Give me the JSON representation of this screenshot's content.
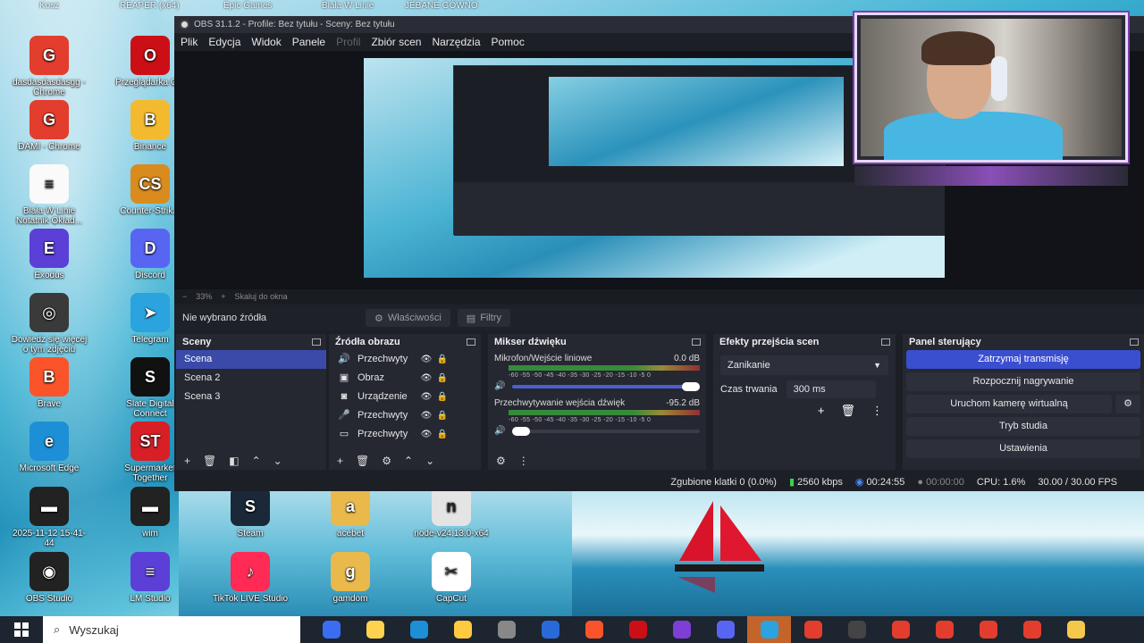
{
  "topbar": {
    "items": [
      "Kosz",
      "REAPER (x64)",
      "Epic Games",
      "Biała W Linie",
      "JEBANE GÓWNO"
    ]
  },
  "desktop": {
    "icons": [
      {
        "label": "dasdasdasdasgg - Chrome",
        "color": "#e33d2e",
        "glyph": "G"
      },
      {
        "label": "Przeglądarka O...",
        "color": "#cc0f16",
        "glyph": "O"
      },
      {
        "label": "DAMI - Chrome",
        "color": "#e33d2e",
        "glyph": "G"
      },
      {
        "label": "Binance",
        "color": "#f3ba2f",
        "glyph": "B"
      },
      {
        "label": "Biała W Linie Notatnik Okład...",
        "color": "#fafafa",
        "glyph": "≡"
      },
      {
        "label": "Counter-Strik...",
        "color": "#d98b1e",
        "glyph": "CS"
      },
      {
        "label": "Exodus",
        "color": "#5b3fd6",
        "glyph": "E"
      },
      {
        "label": "Discord",
        "color": "#5865f2",
        "glyph": "D"
      },
      {
        "label": "Dowiedz się więcej o tym zdjęciu",
        "color": "#3a3a3a",
        "glyph": "◎"
      },
      {
        "label": "Telegram",
        "color": "#2aa3df",
        "glyph": "➤"
      },
      {
        "label": "Brave",
        "color": "#fb542b",
        "glyph": "B"
      },
      {
        "label": "Slate Digital Connect",
        "color": "#111",
        "glyph": "S"
      },
      {
        "label": "Microsoft Edge",
        "color": "#1d8fd6",
        "glyph": "e"
      },
      {
        "label": "Supermarket Together",
        "color": "#d81f26",
        "glyph": "ST"
      },
      {
        "label": "2025-11-12 15-41-44",
        "color": "#222",
        "glyph": "▬"
      },
      {
        "label": "wim",
        "color": "#222",
        "glyph": "▬"
      },
      {
        "label": "Steam",
        "color": "#1b2838",
        "glyph": "S"
      },
      {
        "label": "acebet",
        "color": "#e9b94b",
        "glyph": "a"
      },
      {
        "label": "node-v24.13.0-x64",
        "color": "#e4e4e4",
        "glyph": "n"
      },
      {
        "label": "OBS Studio",
        "color": "#222",
        "glyph": "◉"
      },
      {
        "label": "LM Studio",
        "color": "#5b3fd6",
        "glyph": "≡"
      },
      {
        "label": "TikTok LIVE Studio",
        "color": "#ff2b54",
        "glyph": "♪"
      },
      {
        "label": "gamdom",
        "color": "#e9b94b",
        "glyph": "g"
      },
      {
        "label": "CapCut",
        "color": "#fff",
        "glyph": "✂"
      }
    ]
  },
  "obs": {
    "title": "OBS 31.1.2 - Profile: Bez tytułu - Sceny: Bez tytułu",
    "menu": [
      "Plik",
      "Edycja",
      "Widok",
      "Panele",
      "Profil",
      "Zbiór scen",
      "Narzędzia",
      "Pomoc"
    ],
    "zoom": {
      "minus": "−",
      "value": "33%",
      "plus": "+",
      "fit": "Skaluj do okna"
    },
    "source_bar": {
      "none": "Nie wybrano źródła",
      "props": "Właściwości",
      "filters": "Filtry"
    },
    "scenes": {
      "title": "Sceny",
      "items": [
        "Scena",
        "Scena 2",
        "Scena 3"
      ]
    },
    "sources": {
      "title": "Źródła obrazu",
      "items": [
        {
          "icon": "🔊",
          "name": "Przechwyty"
        },
        {
          "icon": "▣",
          "name": "Obraz"
        },
        {
          "icon": "◙",
          "name": "Urządzenie"
        },
        {
          "icon": "🎤",
          "name": "Przechwyty"
        },
        {
          "icon": "▭",
          "name": "Przechwyty"
        }
      ]
    },
    "mixer": {
      "title": "Mikser dźwięku",
      "ch1": {
        "name": "Mikrofon/Wejście liniowe",
        "db": "0.0 dB"
      },
      "ch2": {
        "name": "Przechwytywanie wejścia dźwięk",
        "db": "-95.2 dB"
      },
      "ticks": "-60 -55 -50 -45 -40 -35 -30 -25 -20 -15 -10 -5 0"
    },
    "transitions": {
      "title": "Efekty przejścia scen",
      "selected": "Zanikanie",
      "duration_label": "Czas trwania",
      "duration": "300 ms"
    },
    "controls": {
      "title": "Panel sterujący",
      "buttons": [
        "Zatrzymaj transmisję",
        "Rozpocznij nagrywanie",
        "Uruchom kamerę wirtualną",
        "Tryb studia",
        "Ustawienia"
      ]
    },
    "status": {
      "dropped": "Zgubione klatki 0 (0.0%)",
      "bitrate": "2560 kbps",
      "stream_time": "00:24:55",
      "rec_time": "00:00:00",
      "cpu": "CPU: 1.6%",
      "fps": "30.00 / 30.00 FPS"
    }
  },
  "taskbar": {
    "search": "Wyszukaj",
    "icons": [
      "#3a6df0",
      "#ffd34d",
      "#1d8fd6",
      "#ffc940",
      "#888",
      "#2a6ad8",
      "#fb542b",
      "#cc0f16",
      "#7e3fd6",
      "#5865f2",
      "#2aa3df",
      "#e33d2e",
      "#444",
      "#e33d2e",
      "#e33d2e",
      "#e33d2e",
      "#e33d2e",
      "#f5c84c"
    ]
  }
}
